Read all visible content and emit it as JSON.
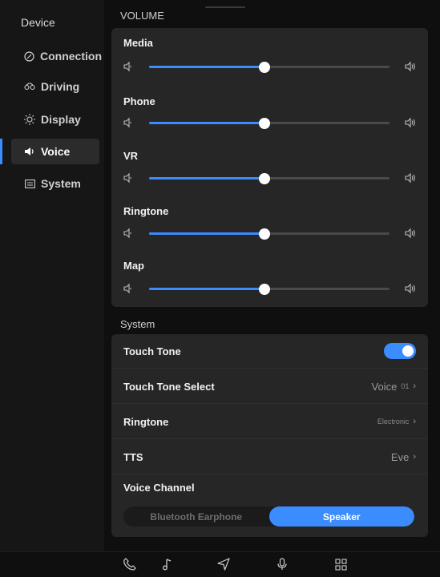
{
  "sidebar": {
    "title": "Device",
    "items": [
      {
        "label": "Connection",
        "icon": "connection-icon",
        "active": false
      },
      {
        "label": "Driving",
        "icon": "driving-icon",
        "active": false
      },
      {
        "label": "Display",
        "icon": "display-icon",
        "active": false
      },
      {
        "label": "Voice",
        "icon": "voice-icon",
        "active": true
      },
      {
        "label": "System",
        "icon": "system-icon",
        "active": false
      }
    ]
  },
  "volume": {
    "title": "VOLUME",
    "sliders": [
      {
        "label": "Media",
        "level": 0.48
      },
      {
        "label": "Phone",
        "level": 0.48
      },
      {
        "label": "VR",
        "level": 0.48
      },
      {
        "label": "Ringtone",
        "level": 0.48
      },
      {
        "label": "Map",
        "level": 0.48
      }
    ]
  },
  "system": {
    "title": "System",
    "touch_tone": {
      "label": "Touch Tone",
      "enabled": true
    },
    "touch_tone_select": {
      "label": "Touch Tone Select",
      "value": "Voice",
      "value_suffix": "01"
    },
    "ringtone": {
      "label": "Ringtone",
      "value": "Electronic"
    },
    "tts": {
      "label": "TTS",
      "value": "Eve"
    },
    "voice_channel": {
      "label": "Voice Channel",
      "options": [
        "Bluetooth Earphone",
        "Speaker"
      ],
      "selected": "Speaker"
    }
  },
  "bottom_bar": {
    "icons": [
      "phone-icon",
      "music-icon",
      "navigation-icon",
      "microphone-icon",
      "apps-grid-icon"
    ]
  },
  "colors": {
    "accent": "#3a8cff",
    "background": "#0f0f0f",
    "panel": "#262626"
  }
}
